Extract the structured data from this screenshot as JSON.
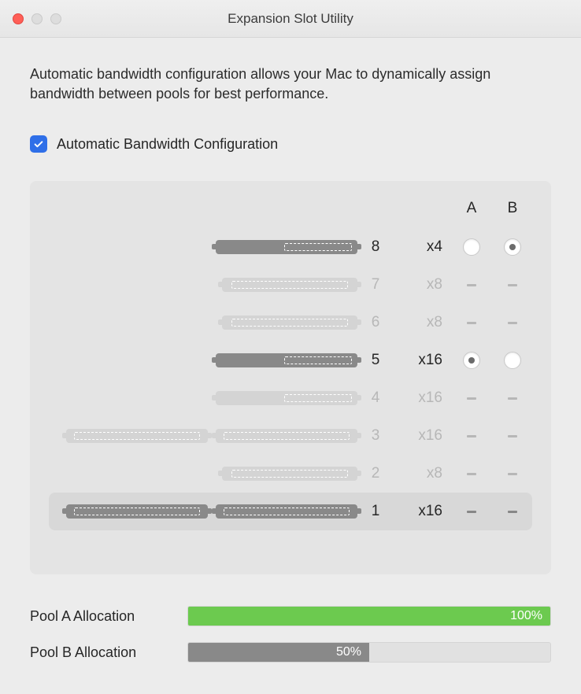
{
  "window": {
    "title": "Expansion Slot Utility"
  },
  "description": "Automatic bandwidth configuration allows your Mac to dynamically assign bandwidth between pools for best performance.",
  "checkbox": {
    "label": "Automatic Bandwidth Configuration",
    "checked": true
  },
  "columns": {
    "a": "A",
    "b": "B"
  },
  "slots": [
    {
      "num": "8",
      "speed": "x4",
      "active": true,
      "dualCard": false,
      "shortCard": false,
      "a": "radio",
      "b": "radio-sel",
      "highlight": false
    },
    {
      "num": "7",
      "speed": "x8",
      "active": false,
      "dualCard": false,
      "shortCard": true,
      "a": "dash",
      "b": "dash",
      "highlight": false
    },
    {
      "num": "6",
      "speed": "x8",
      "active": false,
      "dualCard": false,
      "shortCard": true,
      "a": "dash",
      "b": "dash",
      "highlight": false
    },
    {
      "num": "5",
      "speed": "x16",
      "active": true,
      "dualCard": false,
      "shortCard": false,
      "a": "radio-sel",
      "b": "radio",
      "highlight": false
    },
    {
      "num": "4",
      "speed": "x16",
      "active": false,
      "dualCard": false,
      "shortCard": false,
      "a": "dash",
      "b": "dash",
      "highlight": false
    },
    {
      "num": "3",
      "speed": "x16",
      "active": false,
      "dualCard": true,
      "shortCard": false,
      "a": "dash",
      "b": "dash",
      "highlight": false
    },
    {
      "num": "2",
      "speed": "x8",
      "active": false,
      "dualCard": false,
      "shortCard": true,
      "a": "dash",
      "b": "dash",
      "highlight": false
    },
    {
      "num": "1",
      "speed": "x16",
      "active": true,
      "dualCard": true,
      "shortCard": false,
      "a": "dash-dark",
      "b": "dash-dark",
      "highlight": true
    }
  ],
  "pools": {
    "a": {
      "label": "Pool A Allocation",
      "pct": 100,
      "pct_label": "100%",
      "color": "green"
    },
    "b": {
      "label": "Pool B Allocation",
      "pct": 50,
      "pct_label": "50%",
      "color": "gray"
    }
  }
}
